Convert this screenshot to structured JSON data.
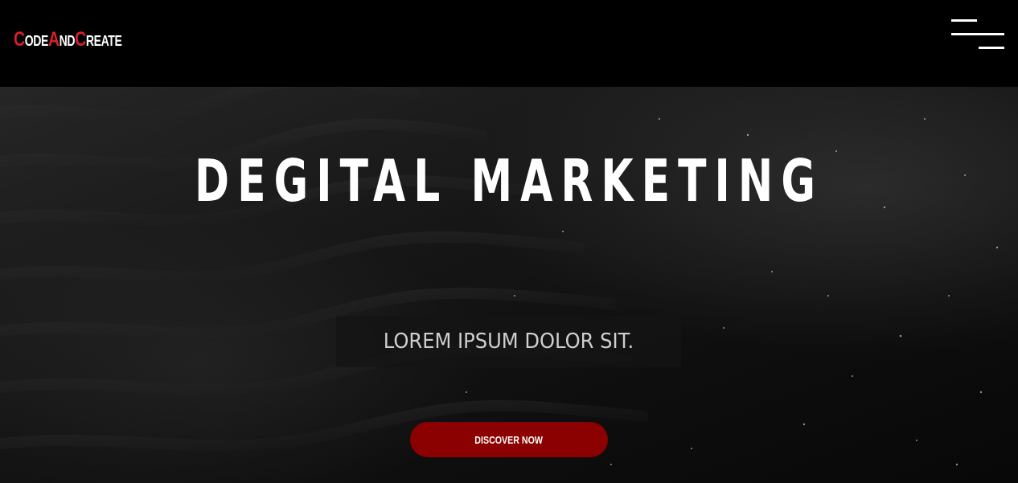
{
  "header": {
    "logo": {
      "parts": [
        {
          "text": "C",
          "style": "cap"
        },
        {
          "text": "ode",
          "style": "low"
        },
        {
          "text": "A",
          "style": "cap"
        },
        {
          "text": "nd",
          "style": "low"
        },
        {
          "text": "C",
          "style": "cap"
        },
        {
          "text": "reate",
          "style": "low"
        }
      ],
      "accent_color": "#d8202b"
    },
    "menu_icon": "hamburger-menu-icon"
  },
  "hero": {
    "headline": "DEGITAL MARKETING",
    "subtitle": "LOREM IPSUM DOLOR SIT.",
    "cta_label": "DISCOVER NOW",
    "cta_color": "#8b0000"
  }
}
